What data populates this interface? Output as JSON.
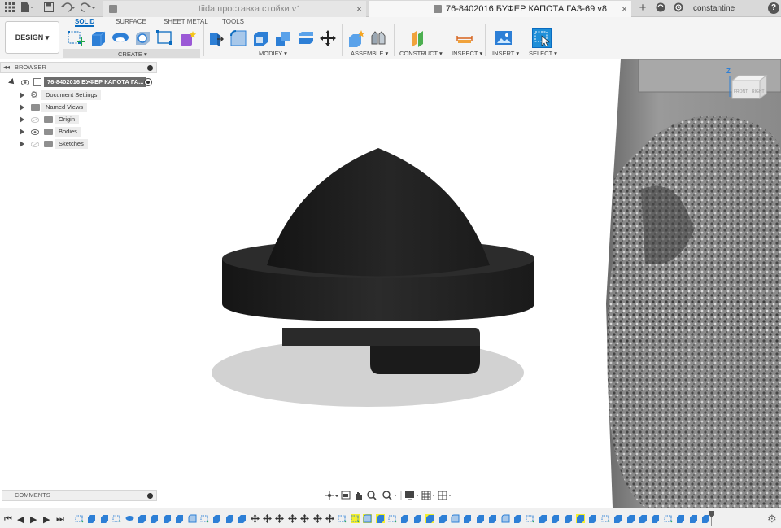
{
  "titlebar": {
    "tab_inactive_title": "tiida проставка стойки v1",
    "tab_active_title": "76-8402016 БУФЕР КАПОТА ГАЗ-69 v8",
    "close_glyph": "×",
    "plus_glyph": "+",
    "user_name": "constantine bogatyrchuk",
    "help_glyph": "?"
  },
  "toolbar": {
    "workspace_label": "DESIGN",
    "workspace_tabs": [
      "SOLID",
      "SURFACE",
      "SHEET METAL",
      "TOOLS"
    ],
    "groups": [
      "CREATE",
      "MODIFY",
      "ASSEMBLE",
      "CONSTRUCT",
      "INSPECT",
      "INSERT",
      "SELECT"
    ]
  },
  "browser": {
    "title": "BROWSER",
    "root": "76-8402016 БУФЕР КАПОТА ГА...",
    "items": [
      "Document Settings",
      "Named Views",
      "Origin",
      "Bodies",
      "Sketches"
    ]
  },
  "comments": {
    "title": "COMMENTS"
  },
  "viewcube": {
    "top_label": "Z",
    "front": "FRONT",
    "right": "RIGHT"
  },
  "colors": {
    "accent": "#0a6bbf",
    "highlight": "#f3ef2b",
    "body": "#1f1f1f",
    "panel": "#f4f4f4"
  }
}
